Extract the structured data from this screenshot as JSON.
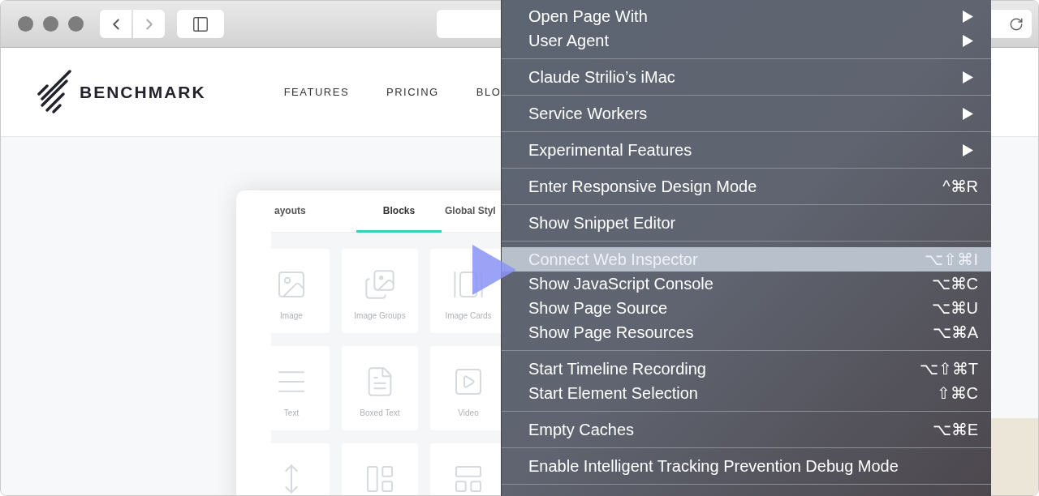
{
  "site": {
    "logo": "BENCHMARK",
    "nav": [
      "FEATURES",
      "PRICING",
      "BLO"
    ]
  },
  "editor": {
    "tabs": [
      {
        "label": "ayouts",
        "selected": false
      },
      {
        "label": "Blocks",
        "selected": true
      },
      {
        "label": "Global Styl",
        "selected": false
      }
    ],
    "blocks": [
      {
        "kind": "image",
        "label": "Image"
      },
      {
        "kind": "image-groups",
        "label": "Image Groups"
      },
      {
        "kind": "image-cards",
        "label": "Image Cards"
      },
      {
        "kind": "text",
        "label": "Text"
      },
      {
        "kind": "boxed-text",
        "label": "Boxed Text"
      },
      {
        "kind": "video",
        "label": "Video"
      },
      {
        "kind": "spacer"
      },
      {
        "kind": "image-left-text"
      },
      {
        "kind": "text-right-image"
      }
    ]
  },
  "menu": [
    [
      {
        "label": "Open Page With",
        "submenu": true,
        "selected": false
      },
      {
        "label": "User Agent",
        "submenu": true,
        "selected": false
      }
    ],
    [
      {
        "label": "Claude Strilio’s iMac",
        "submenu": true,
        "selected": false
      }
    ],
    [
      {
        "label": "Service Workers",
        "submenu": true,
        "selected": false
      }
    ],
    [
      {
        "label": "Experimental Features",
        "submenu": true,
        "selected": false
      }
    ],
    [
      {
        "label": "Enter Responsive Design Mode",
        "shortcut": "^⌘R",
        "selected": false
      }
    ],
    [
      {
        "label": "Show Snippet Editor",
        "selected": false
      }
    ],
    [
      {
        "label": "Connect Web Inspector",
        "shortcut": "⌥⇧⌘I",
        "selected": true
      },
      {
        "label": "Show JavaScript Console",
        "shortcut": "⌥⌘C",
        "selected": false
      },
      {
        "label": "Show Page Source",
        "shortcut": "⌥⌘U",
        "selected": false
      },
      {
        "label": "Show Page Resources",
        "shortcut": "⌥⌘A",
        "selected": false
      }
    ],
    [
      {
        "label": "Start Timeline Recording",
        "shortcut": "⌥⇧⌘T",
        "selected": false
      },
      {
        "label": "Start Element Selection",
        "shortcut": "⇧⌘C",
        "selected": false
      }
    ],
    [
      {
        "label": "Empty Caches",
        "shortcut": "⌥⌘E",
        "selected": false
      }
    ],
    [
      {
        "label": "Enable Intelligent Tracking Prevention Debug Mode",
        "selected": false
      }
    ]
  ]
}
